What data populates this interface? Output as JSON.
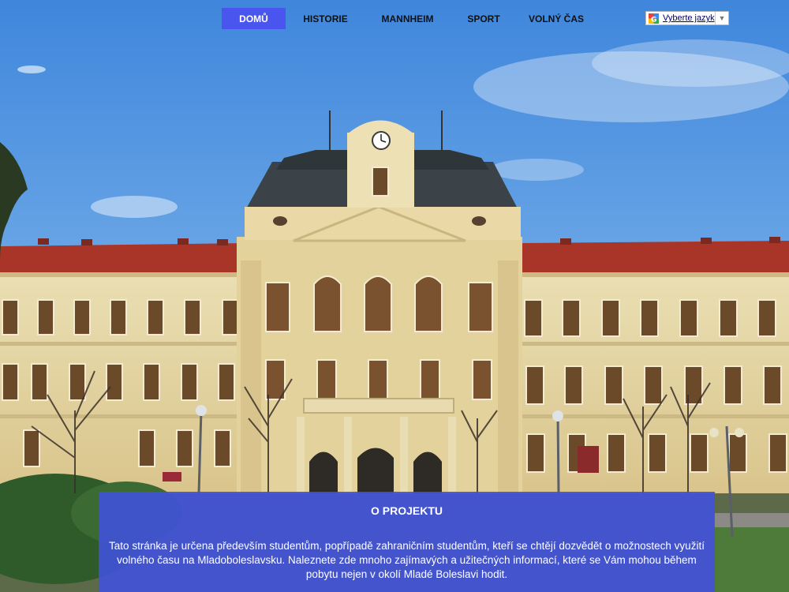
{
  "nav": {
    "items": [
      {
        "label": "DOMŮ",
        "active": true
      },
      {
        "label": "HISTORIE",
        "active": false
      },
      {
        "label": "MANNHEIM",
        "active": false
      },
      {
        "label": "SPORT",
        "active": false
      },
      {
        "label": "VOLNÝ ČAS",
        "active": false
      }
    ]
  },
  "language_selector": {
    "label": "Vyberte jazyk",
    "icon": "google-translate-icon",
    "arrow_icon": "triangle-down-icon"
  },
  "project": {
    "title": "O PROJEKTU",
    "text": "Tato stránka je určena především studentům, popřípadě zahraničním studentům, kteří se chtějí dozvědět o možnostech využití volného času na Mladoboleslavsku. Naleznete zde mnoho zajímavých a užitečných informací, které se Vám mohou během pobytu nejen v okolí Mladé Boleslavi hodit."
  },
  "colors": {
    "nav_active": "#4a55ef",
    "project_box": "#4152d7",
    "sky": "#4f8fd8",
    "facade": "#e6d7a6",
    "roof": "#b0342a"
  }
}
